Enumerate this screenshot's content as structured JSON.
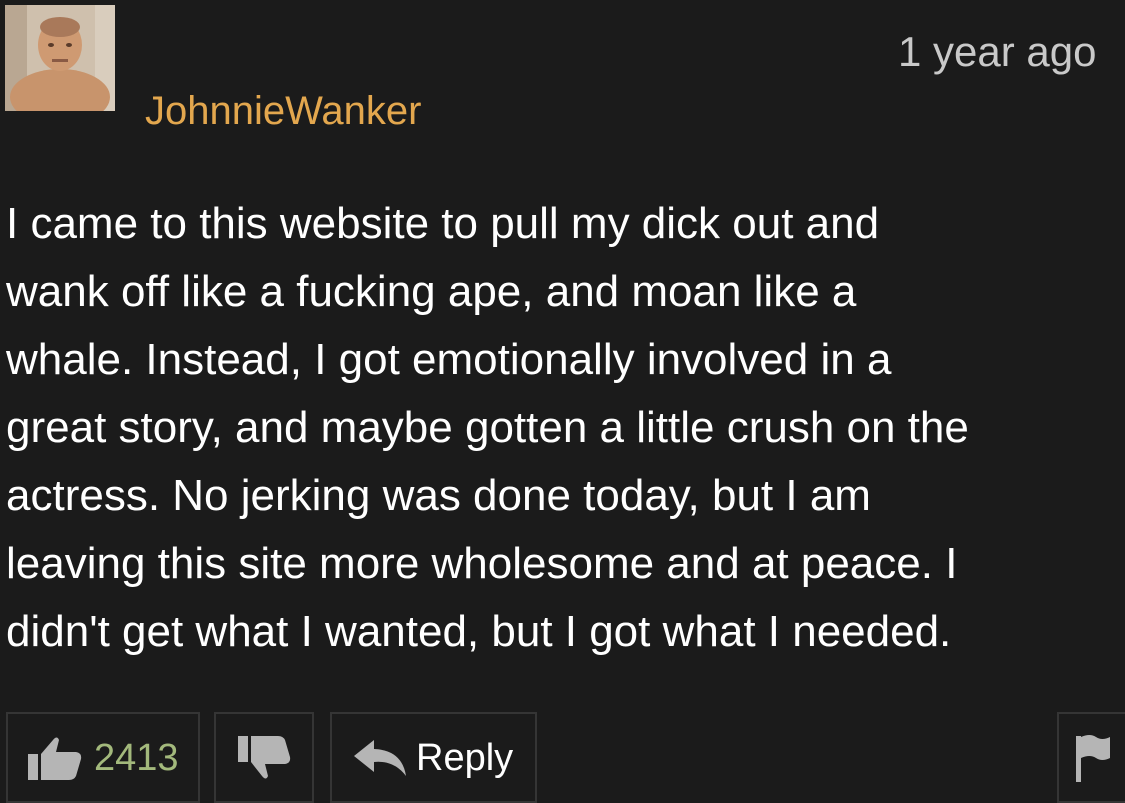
{
  "comment": {
    "username": "JohnnieWanker",
    "timestamp": "1 year ago",
    "body_lines": [
      "I came to this website to pull my dick out and",
      "wank off like a fucking ape, and moan like a",
      "whale. Instead, I got emotionally involved in a",
      "great story, and maybe gotten a little crush on the",
      "actress. No jerking was done today, but I am",
      "leaving this site more wholesome and at peace. I",
      "didn't get what I wanted, but I got what I needed."
    ],
    "avatar_icon": "user-avatar-photo"
  },
  "actions": {
    "like_count": "2413",
    "like_icon": "thumbs-up-icon",
    "dislike_icon": "thumbs-down-icon",
    "reply_label": "Reply",
    "reply_icon": "reply-arrow-icon",
    "flag_icon": "flag-icon"
  },
  "colors": {
    "background": "#1b1b1b",
    "username": "#e3a74e",
    "like_count": "#a3b97c",
    "timestamp": "#c9c9c9",
    "button_border": "#353535",
    "icon": "#b5b5b5"
  }
}
